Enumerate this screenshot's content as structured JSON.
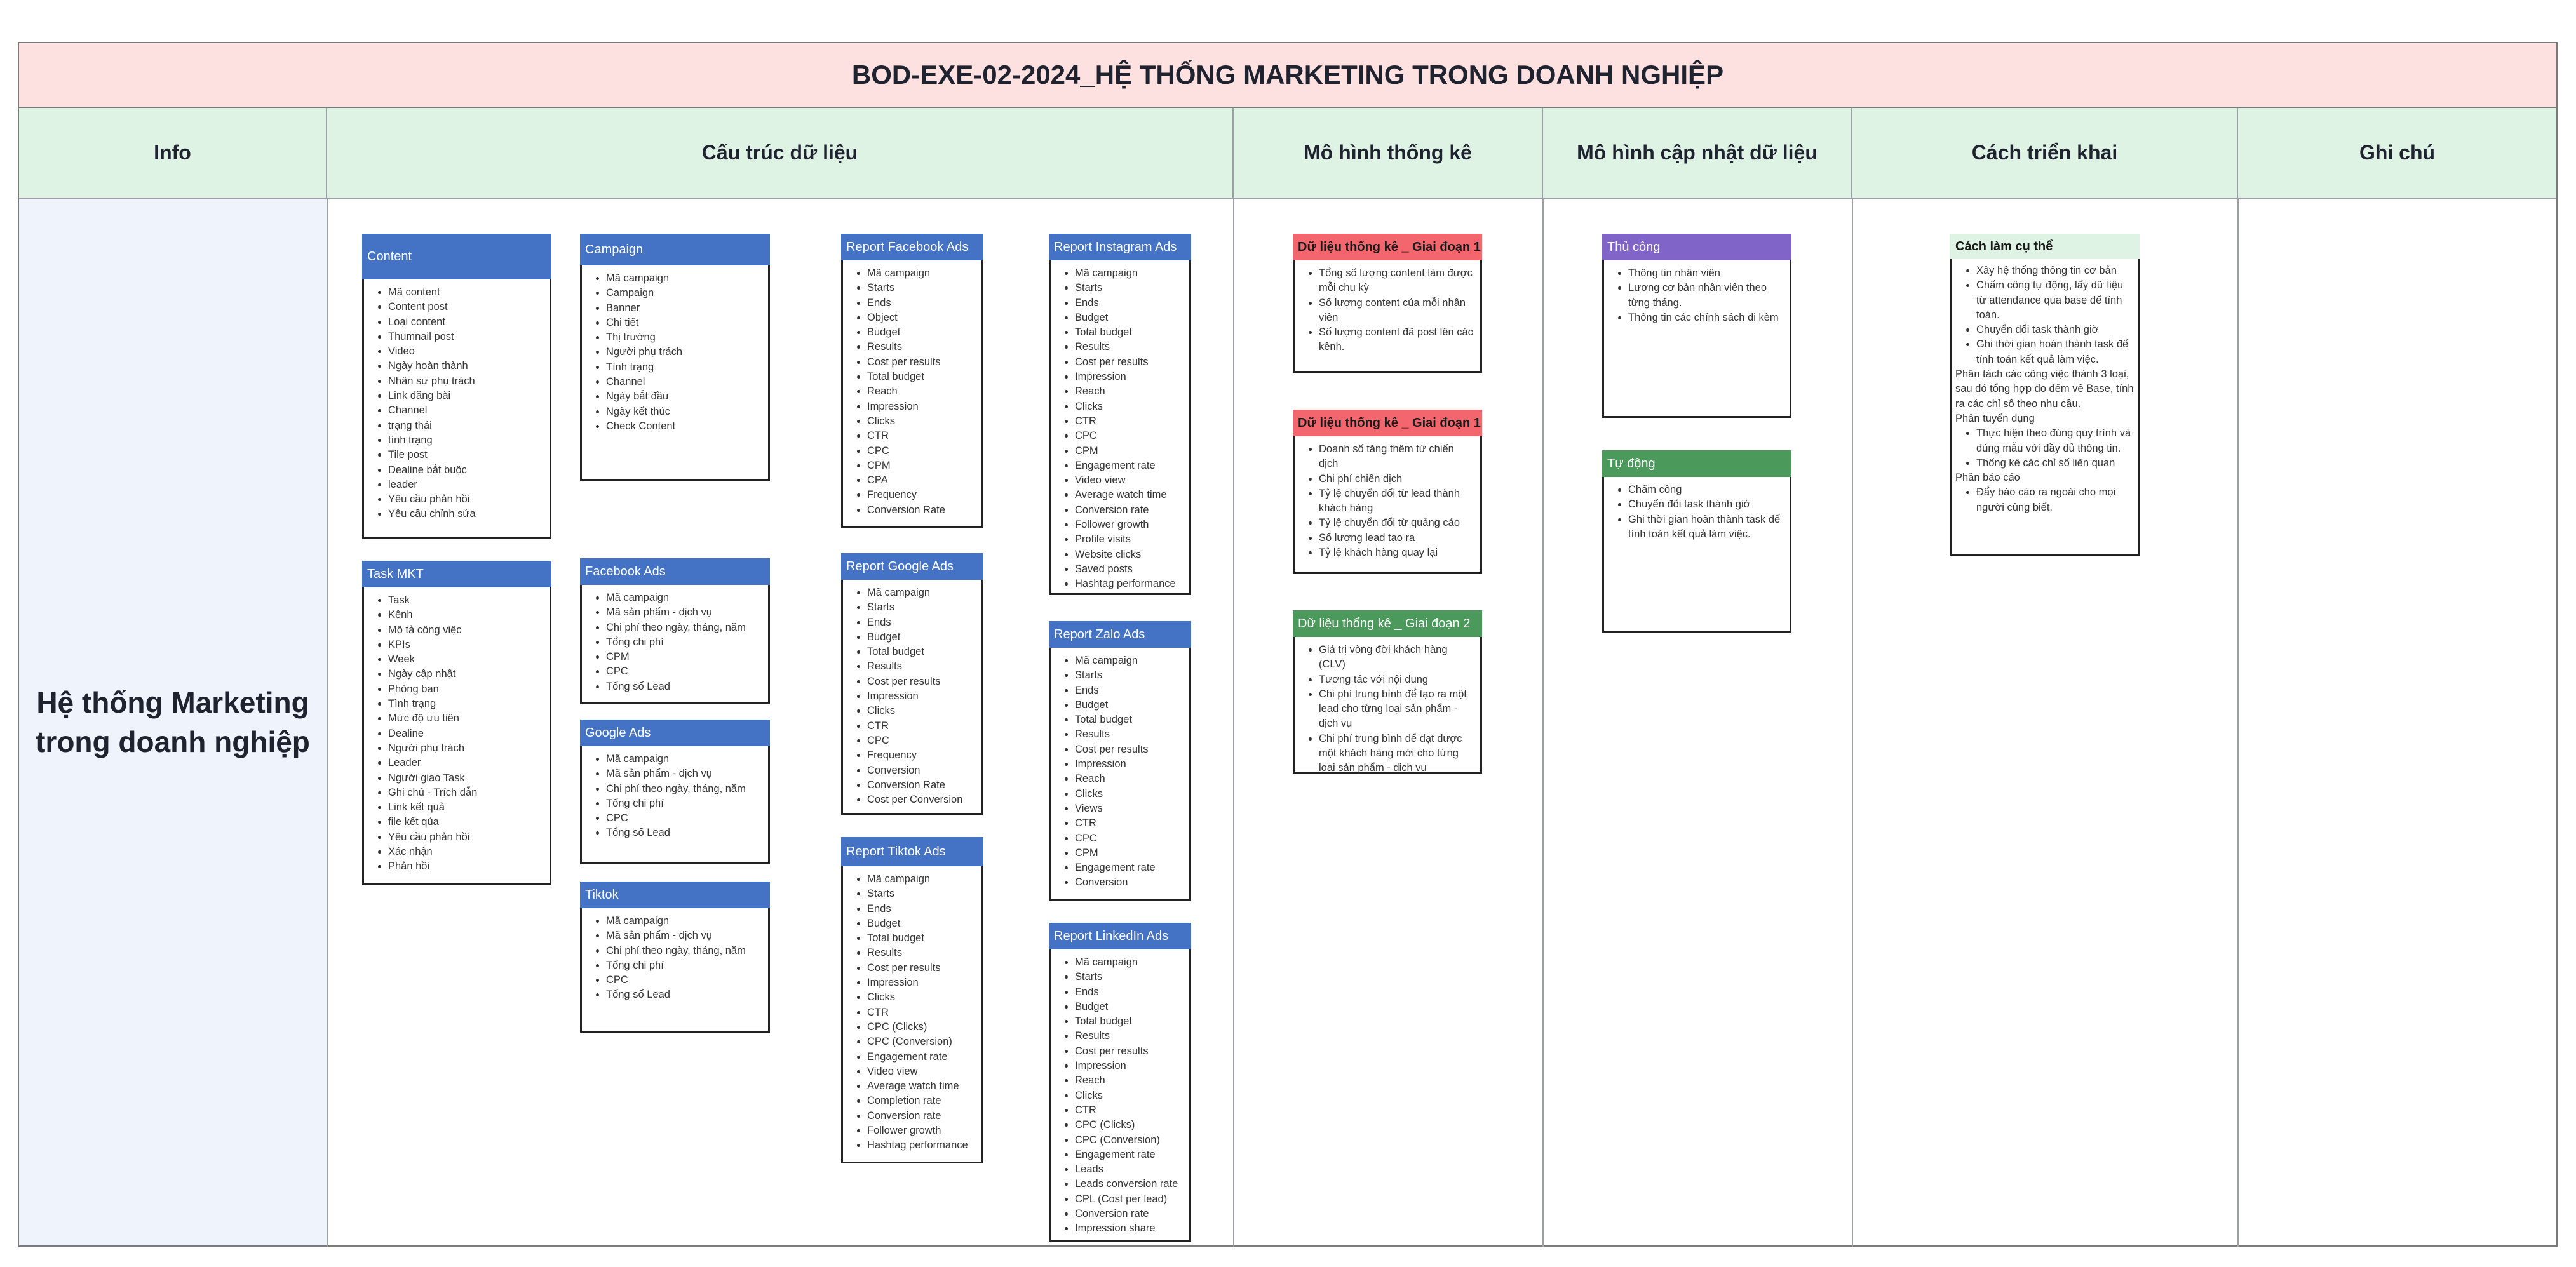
{
  "title": "BOD-EXE-02-2024_HỆ THỐNG MARKETING TRONG DOANH NGHIỆP",
  "headers": {
    "info": "Info",
    "structure": "Cấu trúc dữ liệu",
    "stats": "Mô hình thống kê",
    "update": "Mô hình cập nhật dữ liệu",
    "deploy": "Cách triển khai",
    "notes": "Ghi chú"
  },
  "info_title_line1": "Hệ thống Marketing",
  "info_title_line2": "trong doanh nghiệp",
  "colors": {
    "title_bg": "#fde0e0",
    "header_bg": "#dff3e4",
    "info_bg": "#eef3fc",
    "blue": "#4472c4",
    "red": "#f4666e",
    "purple": "#8064c8",
    "green": "#4b9a5c",
    "mint": "#dff3e4"
  },
  "cards": {
    "content": {
      "title": "Content",
      "items": [
        "Mã content",
        "Content post",
        "Loại content",
        "Thumnail post",
        "Video",
        "Ngày hoàn thành",
        "Nhân sự phụ trách",
        "Link đăng bài",
        "Channel",
        "trạng thái",
        "tình trạng",
        "Tile post",
        "Dealine bắt buộc",
        "leader",
        "Yêu cầu phản hồi",
        "Yêu cầu chỉnh sửa"
      ]
    },
    "task": {
      "title": "Task MKT",
      "items": [
        "Task",
        "Kênh",
        "Mô tả công việc",
        "KPIs",
        "Week",
        "Ngày cập nhật",
        "Phòng ban",
        "Tình trạng",
        "Mức độ ưu tiên",
        "Dealine",
        "Người phụ trách",
        "Leader",
        "Người giao Task",
        "Ghi chú - Trích dẫn",
        "Link kết quả",
        "file kết qủa",
        "Yêu cầu phản hồi",
        "Xác nhận",
        "Phản hồi"
      ]
    },
    "campaign": {
      "title": "Campaign",
      "items": [
        "Mã campaign",
        "Campaign",
        "Banner",
        "Chi tiết",
        "Thị trường",
        "Người phụ trách",
        "Tình trạng",
        "Channel",
        "Ngày bắt đầu",
        "Ngày kết thúc",
        "Check Content"
      ]
    },
    "facebook": {
      "title": "Facebook Ads",
      "items": [
        "Mã campaign",
        "Mã sản phẩm - dịch vụ",
        "Chi phí theo ngày, tháng, năm",
        "Tổng chi phí",
        "CPM",
        "CPC",
        "Tổng số Lead"
      ]
    },
    "google": {
      "title": "Google Ads",
      "items": [
        "Mã campaign",
        "Mã sản phẩm - dịch vụ",
        "Chi phí theo ngày, tháng, năm",
        "Tổng chi phí",
        "CPC",
        "Tổng số Lead"
      ]
    },
    "tiktok": {
      "title": "Tiktok",
      "items": [
        "Mã campaign",
        "Mã sản phẩm - dịch vụ",
        "Chi phí theo ngày, tháng, năm",
        "Tổng chi phí",
        "CPC",
        "Tổng số Lead"
      ]
    },
    "report_fb": {
      "title": "Report Facebook Ads",
      "items": [
        "Mã campaign",
        "Starts",
        "Ends",
        "Object",
        "Budget",
        "Results",
        "Cost per results",
        "Total budget",
        "Reach",
        "Impression",
        "Clicks",
        "CTR",
        "CPC",
        "CPM",
        "CPA",
        "Frequency",
        "Conversion Rate"
      ]
    },
    "report_gg": {
      "title": "Report Google Ads",
      "items": [
        "Mã campaign",
        "Starts",
        "Ends",
        "Budget",
        "Total budget",
        "Results",
        "Cost per results",
        "Impression",
        "Clicks",
        "CTR",
        "CPC",
        "Frequency",
        "Conversion",
        "Conversion Rate",
        "Cost per Conversion"
      ]
    },
    "report_tt": {
      "title": "Report Tiktok Ads",
      "items": [
        "Mã campaign",
        "Starts",
        "Ends",
        "Budget",
        "Total budget",
        "Results",
        "Cost per results",
        "Impression",
        "Clicks",
        "CTR",
        "CPC (Clicks)",
        "CPC (Conversion)",
        "Engagement rate",
        "Video view",
        "Average watch time",
        "Completion rate",
        "Conversion rate",
        "Follower growth",
        "Hashtag performance"
      ]
    },
    "report_ig": {
      "title": "Report Instagram Ads",
      "items": [
        "Mã campaign",
        "Starts",
        "Ends",
        "Budget",
        "Total budget",
        "Results",
        "Cost per results",
        "Impression",
        "Reach",
        "Clicks",
        "CTR",
        "CPC",
        "CPM",
        "Engagement rate",
        "Video view",
        "Average watch time",
        "Conversion rate",
        "Follower growth",
        "Profile visits",
        "Website clicks",
        "Saved posts",
        "Hashtag performance"
      ]
    },
    "report_zalo": {
      "title": "Report Zalo Ads",
      "items": [
        "Mã campaign",
        "Starts",
        "Ends",
        "Budget",
        "Total budget",
        "Results",
        "Cost per results",
        "Impression",
        "Reach",
        "Clicks",
        "Views",
        "CTR",
        "CPC",
        "CPM",
        "Engagement rate",
        "Conversion"
      ]
    },
    "report_li": {
      "title": "Report LinkedIn Ads",
      "items": [
        "Mã campaign",
        "Starts",
        "Ends",
        "Budget",
        "Total budget",
        "Results",
        "Cost per results",
        "Impression",
        "Reach",
        "Clicks",
        "CTR",
        "CPC (Clicks)",
        "CPC (Conversion)",
        "Engagement rate",
        "Leads",
        "Leads conversion rate",
        "CPL (Cost per lead)",
        "Conversion rate",
        "Impression share"
      ]
    },
    "stat1": {
      "title": "Dữ liệu thống kê _ Giai đoạn 1",
      "items": [
        "Tổng số lượng content làm được mỗi chu kỳ",
        "Số lượng content của mỗi nhân viên",
        "Số lượng content đã post lên các kênh."
      ]
    },
    "stat2": {
      "title": "Dữ liệu thống kê _ Giai đoạn 1",
      "items": [
        "Doanh số tăng thêm từ chiến dịch",
        "Chi phí chiến dịch",
        "Tỷ lệ chuyển đổi từ lead thành khách hàng",
        "Tỷ lệ chuyển đổi từ quảng cáo",
        "Số lượng lead tạo ra",
        "Tỷ lệ khách hàng quay lại"
      ]
    },
    "stat3": {
      "title": "Dữ liệu thống kê _ Giai đoạn 2",
      "items": [
        "Giá trị vòng đời khách hàng (CLV)",
        "Tương tác với nội dung",
        "Chi phí trung bình để tạo ra một lead cho từng loại sản phẩm - dịch vụ",
        "Chi phí trung bình để đạt được một khách hàng mới cho từng loại sản phẩm - dịch vụ"
      ]
    },
    "manual": {
      "title": "Thủ công",
      "items": [
        "Thông tin nhân viên",
        "Lương cơ bản nhân viên theo từng tháng.",
        "Thông tin các chính sách đi kèm"
      ]
    },
    "auto": {
      "title": "Tự động",
      "items": [
        "Chấm công",
        "Chuyển đổi task thành giờ",
        "Ghi thời gian hoàn thành task để tính toán  kết quả làm việc."
      ]
    },
    "deploy": {
      "title": "Cách làm cụ thể",
      "items1": [
        "Xây hệ thống thông tin cơ bản",
        "Chấm công tự động, lấy dữ liệu từ attendance qua base để tính toán.",
        "Chuyển đổi task thành giờ",
        "Ghi thời gian hoàn thành task để tính toán  kết quả làm việc."
      ],
      "para1": "Phân tách các công việc thành 3 loại, sau đó tổng hợp đo đếm về Base, tính ra các chỉ số theo nhu cầu.",
      "para2": "Phân tuyển dụng",
      "items2": [
        "Thực hiện theo đúng quy trình và đúng mẫu với đầy đủ thông tin.",
        "Thống kê các chỉ số liên quan"
      ],
      "para3": "Phần báo cáo",
      "items3": [
        "Đẩy báo cáo ra ngoài cho mọi người cùng biết."
      ]
    }
  }
}
